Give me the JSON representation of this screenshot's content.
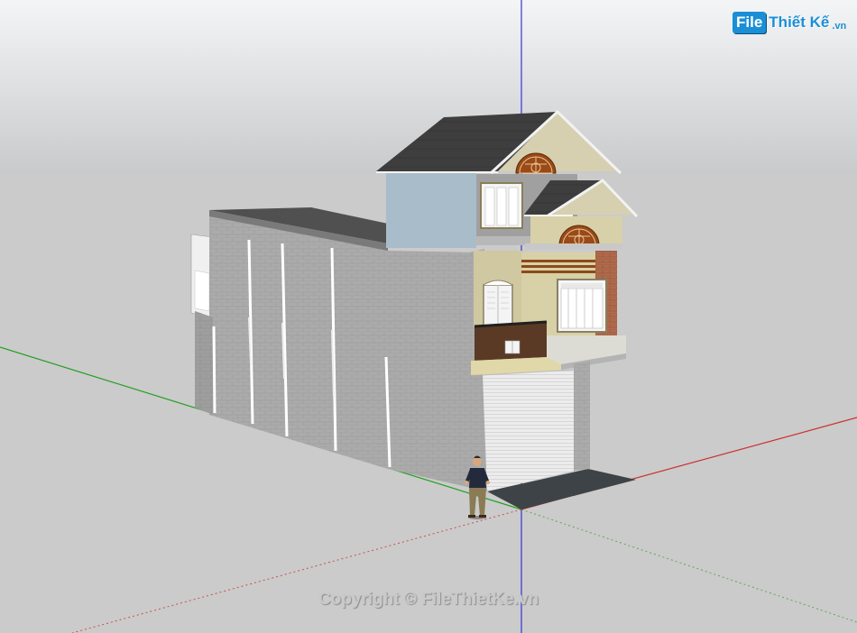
{
  "app": {
    "view": "3D model viewport",
    "colors": {
      "sky_top": "#f3f4f5",
      "sky_bottom": "#c9cbcd",
      "ground": "#cbcbcb",
      "axis_blue": "#3232d8",
      "axis_red": "#d23030",
      "axis_green": "#24a024",
      "wall_gray": "#a9a9a9",
      "roof_dark": "#3d3d3d",
      "facade_beige": "#d8d0a4",
      "wood_brown": "#8a4a14"
    }
  },
  "watermark": {
    "logo_box": "File",
    "logo_rest": "Thiết Kế",
    "logo_tld": ".vn",
    "copyright": "Copyright © FileThietKe.vn"
  },
  "icons": {
    "person": "person-figure-icon"
  }
}
